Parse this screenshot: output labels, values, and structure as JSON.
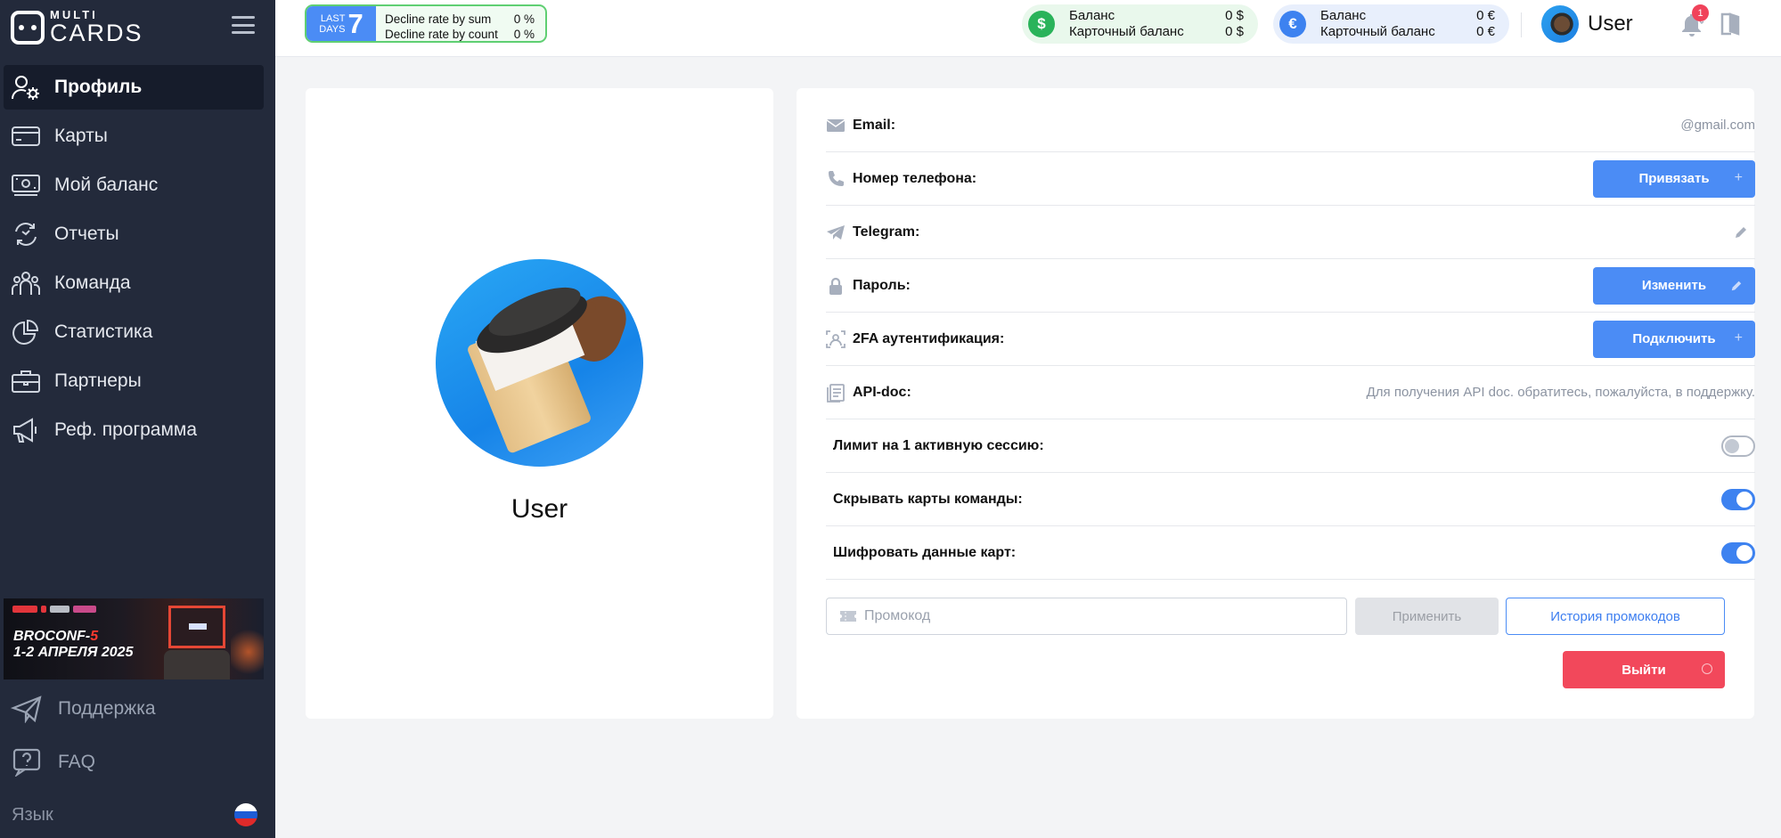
{
  "brand": {
    "logo_top": "MULTI",
    "logo_bottom": "CARDS"
  },
  "sidebar": {
    "items": [
      {
        "label": "Профиль",
        "icon": "profile-gear-icon",
        "active": true
      },
      {
        "label": "Карты",
        "icon": "card-icon"
      },
      {
        "label": "Мой баланс",
        "icon": "balance-icon"
      },
      {
        "label": "Отчеты",
        "icon": "reports-icon"
      },
      {
        "label": "Команда",
        "icon": "team-icon"
      },
      {
        "label": "Статистика",
        "icon": "pie-chart-icon"
      },
      {
        "label": "Партнеры",
        "icon": "briefcase-icon"
      },
      {
        "label": "Реф. программа",
        "icon": "megaphone-icon"
      }
    ],
    "banner": {
      "line1": "BROCONF-",
      "line1_accent": "5",
      "line2": "1-2 АПРЕЛЯ 2025"
    },
    "support_label": "Поддержка",
    "faq_label": "FAQ",
    "language_label": "Язык"
  },
  "topbar": {
    "last_days": {
      "word1": "LAST",
      "word2": "DAYS",
      "value": "7",
      "rows": [
        {
          "label": "Decline rate by sum",
          "value": "0 %"
        },
        {
          "label": "Decline rate by count",
          "value": "0 %"
        }
      ]
    },
    "balance_usd": {
      "icon": "$",
      "label": "Баланс",
      "value": "0 $",
      "card_label": "Карточный баланс",
      "card_value": "0 $"
    },
    "balance_eur": {
      "icon": "€",
      "label": "Баланс",
      "value": "0 €",
      "card_label": "Карточный баланс",
      "card_value": "0 €"
    },
    "user_name": "User",
    "notification_count": "1"
  },
  "profile": {
    "name": "User"
  },
  "settings": {
    "email": {
      "label": "Email:",
      "value": "@gmail.com"
    },
    "phone": {
      "label": "Номер телефона:",
      "button": "Привязать",
      "button_suffix": "+"
    },
    "telegram": {
      "label": "Telegram:"
    },
    "password": {
      "label": "Пароль:",
      "button": "Изменить"
    },
    "twofa": {
      "label": "2FA аутентификация:",
      "button": "Подключить",
      "button_suffix": "+"
    },
    "api": {
      "label": "API-doc:",
      "value": "Для получения API doc. обратитесь, пожалуйста, в поддержку."
    },
    "session_limit": {
      "label": "Лимит на 1 активную сессию:",
      "enabled": false
    },
    "hide_team_cards": {
      "label": "Скрывать карты команды:",
      "enabled": true
    },
    "encrypt_cards": {
      "label": "Шифровать данные карт:",
      "enabled": true
    }
  },
  "promo": {
    "placeholder": "Промокод",
    "apply": "Применить",
    "history": "История промокодов"
  },
  "logout_label": "Выйти",
  "colors": {
    "accent": "#4b8cf5",
    "danger": "#f2485b",
    "sidebar": "#232a3b",
    "success": "#2ab35a"
  }
}
